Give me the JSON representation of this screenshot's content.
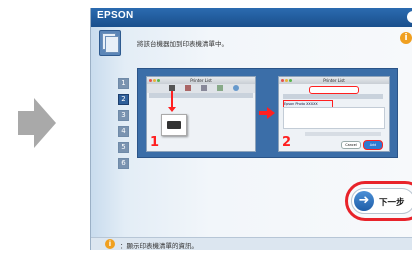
{
  "window": {
    "brand": "EPSON"
  },
  "nav": {
    "steps": [
      "1",
      "2",
      "3",
      "4",
      "5",
      "6"
    ]
  },
  "main": {
    "instruction": "將該台機器加到印表機清單中。"
  },
  "illustration": {
    "left_dialog": {
      "title": "Printer List"
    },
    "right_dialog": {
      "title": "Printer List",
      "selected_printer": "Epson Photo XXXXX",
      "cancel_label": "Cancel",
      "add_label": "Add"
    },
    "step1_label": "1",
    "step2_label": "2"
  },
  "footer": {
    "hint": "：顯示印表機清單的資訊。"
  },
  "next_button": {
    "label": "下一步"
  },
  "colors": {
    "titlebar": "#1a4f8c",
    "highlight": "#e8232a",
    "accent_arrow": "#ff2020",
    "info": "#f0a020"
  }
}
